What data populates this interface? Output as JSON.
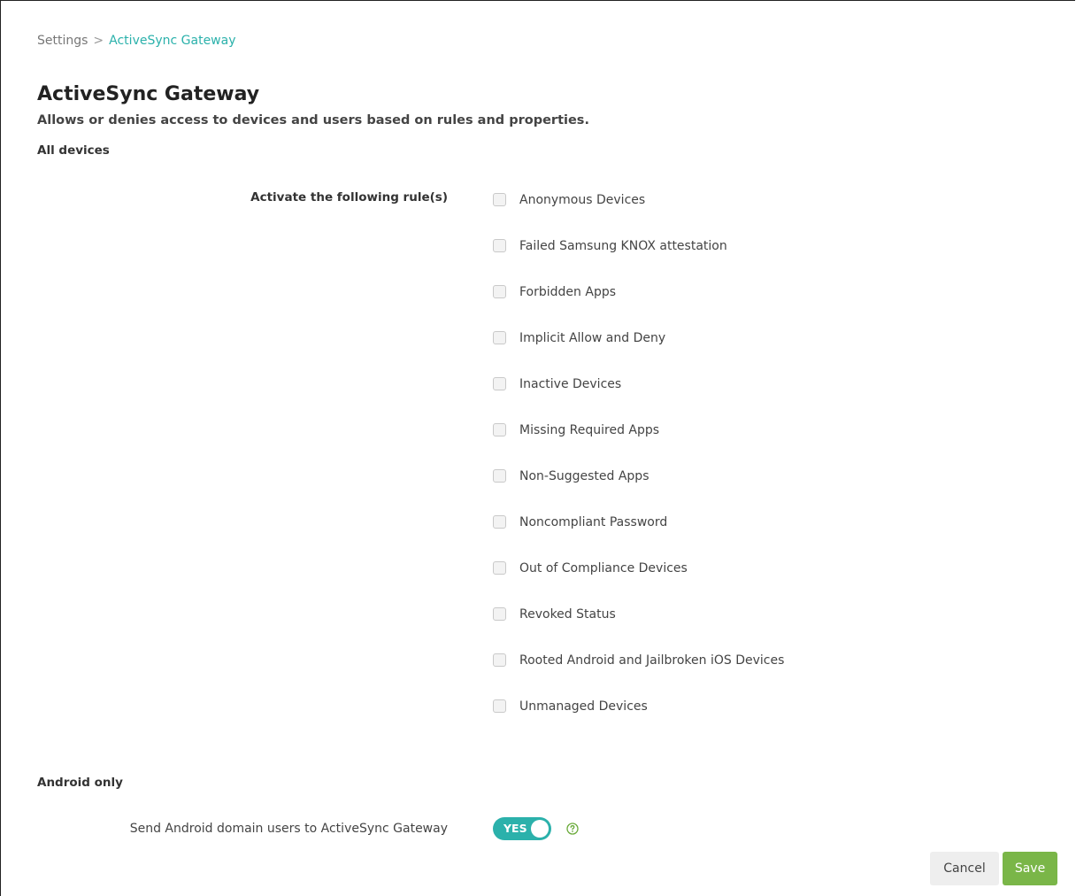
{
  "breadcrumb": {
    "root": "Settings",
    "separator": ">",
    "current": "ActiveSync Gateway"
  },
  "page": {
    "title": "ActiveSync Gateway",
    "description": "Allows or denies access to devices and users based on rules and properties."
  },
  "all_devices": {
    "heading": "All devices",
    "rules_label": "Activate the following rule(s)",
    "rules": [
      {
        "label": "Anonymous Devices",
        "checked": false
      },
      {
        "label": "Failed Samsung KNOX attestation",
        "checked": false
      },
      {
        "label": "Forbidden Apps",
        "checked": false
      },
      {
        "label": "Implicit Allow and Deny",
        "checked": false
      },
      {
        "label": "Inactive Devices",
        "checked": false
      },
      {
        "label": "Missing Required Apps",
        "checked": false
      },
      {
        "label": "Non-Suggested Apps",
        "checked": false
      },
      {
        "label": "Noncompliant Password",
        "checked": false
      },
      {
        "label": "Out of Compliance Devices",
        "checked": false
      },
      {
        "label": "Revoked Status",
        "checked": false
      },
      {
        "label": "Rooted Android and Jailbroken iOS Devices",
        "checked": false
      },
      {
        "label": "Unmanaged Devices",
        "checked": false
      }
    ]
  },
  "android_only": {
    "heading": "Android only",
    "send_domain_users": {
      "label": "Send Android domain users to ActiveSync Gateway",
      "toggle_text": "YES",
      "enabled": true,
      "help_icon": "question-circle-icon"
    }
  },
  "actions": {
    "cancel_label": "Cancel",
    "save_label": "Save"
  },
  "colors": {
    "accent_teal": "#2bb1ab",
    "save_green": "#7ab648",
    "cancel_gray": "#eeeeee",
    "help_green": "#6aaa3a"
  }
}
